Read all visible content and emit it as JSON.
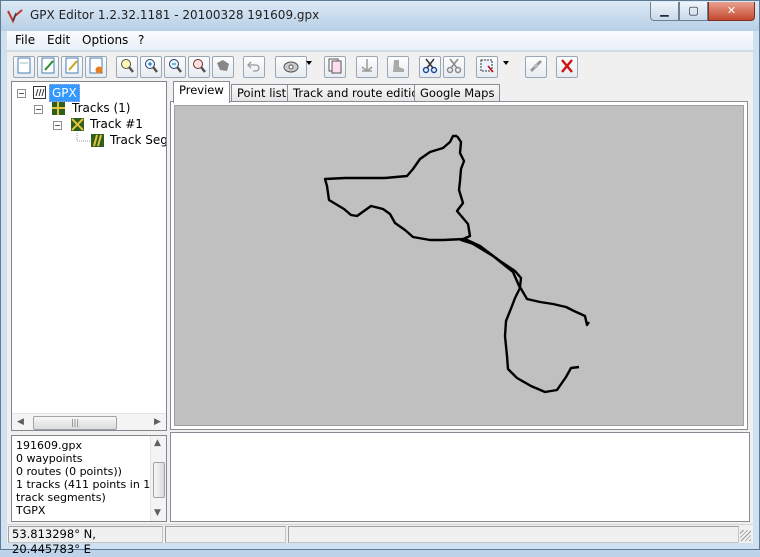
{
  "window": {
    "title": "GPX Editor 1.2.32.1181 - 20100328 191609.gpx"
  },
  "menu": [
    "File",
    "Edit",
    "Options",
    "?"
  ],
  "toolbar": {
    "icons": [
      "new-file-icon",
      "edit-file-icon",
      "edit-file-alt-icon",
      "file-orange-icon",
      "zoom-fit-icon",
      "zoom-in-icon",
      "zoom-out-icon",
      "zoom-reset-icon",
      "map-region-icon",
      "undo-icon",
      "gps-device-icon",
      "copy-pages-icon",
      "anchor-icon",
      "boot-icon",
      "scissors-blue-icon",
      "scissors-gray-icon",
      "select-area-icon",
      "satellite-icon",
      "delete-x-icon"
    ]
  },
  "tree": {
    "root": "GPX",
    "tracks": "Tracks (1)",
    "track": "Track #1",
    "segment": "Track Segment"
  },
  "info": [
    "191609.gpx",
    "0 waypoints",
    "0 routes (0 points))",
    "1 tracks (411 points in 1",
    "track segments)",
    "TGPX"
  ],
  "tabs": [
    "Preview",
    "Point list",
    "Track and route edition",
    "Google Maps"
  ],
  "active_tab": "Preview",
  "status": {
    "coords": "53.813298° N, 20.445783° E",
    "cell2": "",
    "cell3": ""
  },
  "colors": {
    "canvas": "#c0c0c0",
    "track": "#000000",
    "selection": "#3399ff"
  }
}
